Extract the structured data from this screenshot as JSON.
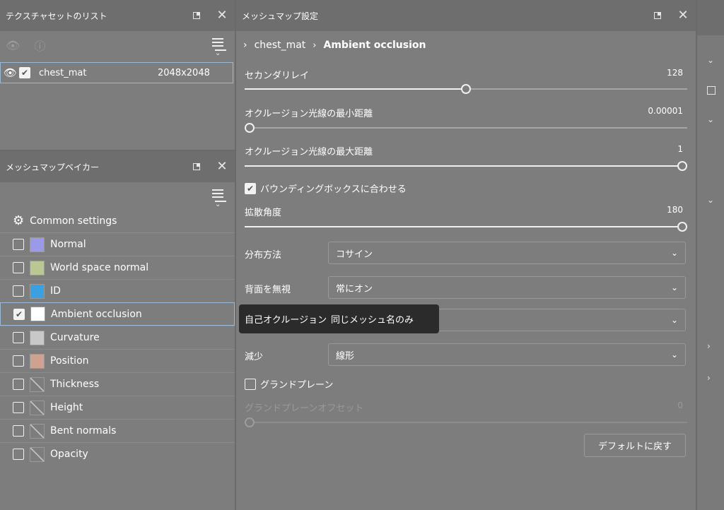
{
  "texture_list": {
    "title": "テクスチャセットのリスト",
    "item": {
      "name": "chest_mat",
      "resolution": "2048x2048",
      "checked": true
    }
  },
  "baker": {
    "title": "メッシュマップベイカー",
    "common_label": "Common settings",
    "items": [
      {
        "label": "Normal",
        "checked": false,
        "thumb_color": "#9a9ae8"
      },
      {
        "label": "World space normal",
        "checked": false,
        "thumb_color": "#b8c890"
      },
      {
        "label": "ID",
        "checked": false,
        "thumb_color": "#3aa0e0"
      },
      {
        "label": "Ambient occlusion",
        "checked": true,
        "thumb_color": "#ffffff"
      },
      {
        "label": "Curvature",
        "checked": false,
        "thumb_color": "#c8c8c8"
      },
      {
        "label": "Position",
        "checked": false,
        "thumb_color": "#d0a090"
      },
      {
        "label": "Thickness",
        "checked": false,
        "thumb_color": "#7d7d7d"
      },
      {
        "label": "Height",
        "checked": false,
        "thumb_color": "#7d7d7d"
      },
      {
        "label": "Bent normals",
        "checked": false,
        "thumb_color": "#7d7d7d"
      },
      {
        "label": "Opacity",
        "checked": false,
        "thumb_color": "#7d7d7d"
      }
    ]
  },
  "mesh": {
    "title": "メッシュマップ設定",
    "breadcrumb": [
      "chest_mat",
      "Ambient occlusion"
    ],
    "secondary_rays": {
      "label": "セカンダリレイ",
      "value": "128",
      "fraction": 0.5
    },
    "min_dist": {
      "label": "オクルージョン光線の最小距離",
      "value": "0.00001",
      "fraction": 0.0
    },
    "max_dist": {
      "label": "オクルージョン光線の最大距離",
      "value": "1",
      "fraction": 1.0
    },
    "fit_bbox": {
      "label": "バウンディングボックスに合わせる",
      "checked": true
    },
    "spread_angle": {
      "label": "拡散角度",
      "value": "180",
      "fraction": 1.0
    },
    "distribution": {
      "label": "分布方法",
      "value": "コサイン"
    },
    "ignore_backface": {
      "label": "背面を無視",
      "value": "常にオン"
    },
    "self_occlusion": {
      "label": "自己オクルージョン",
      "tooltip": "同じメッシュ名のみ"
    },
    "attenuation": {
      "label": "減少",
      "value": "線形"
    },
    "ground_plane": {
      "label": "グランドプレーン",
      "checked": false
    },
    "ground_offset": {
      "label": "グランドプレーンオフセット",
      "value": "0",
      "fraction": 0.0
    },
    "reset_label": "デフォルトに戻す"
  }
}
